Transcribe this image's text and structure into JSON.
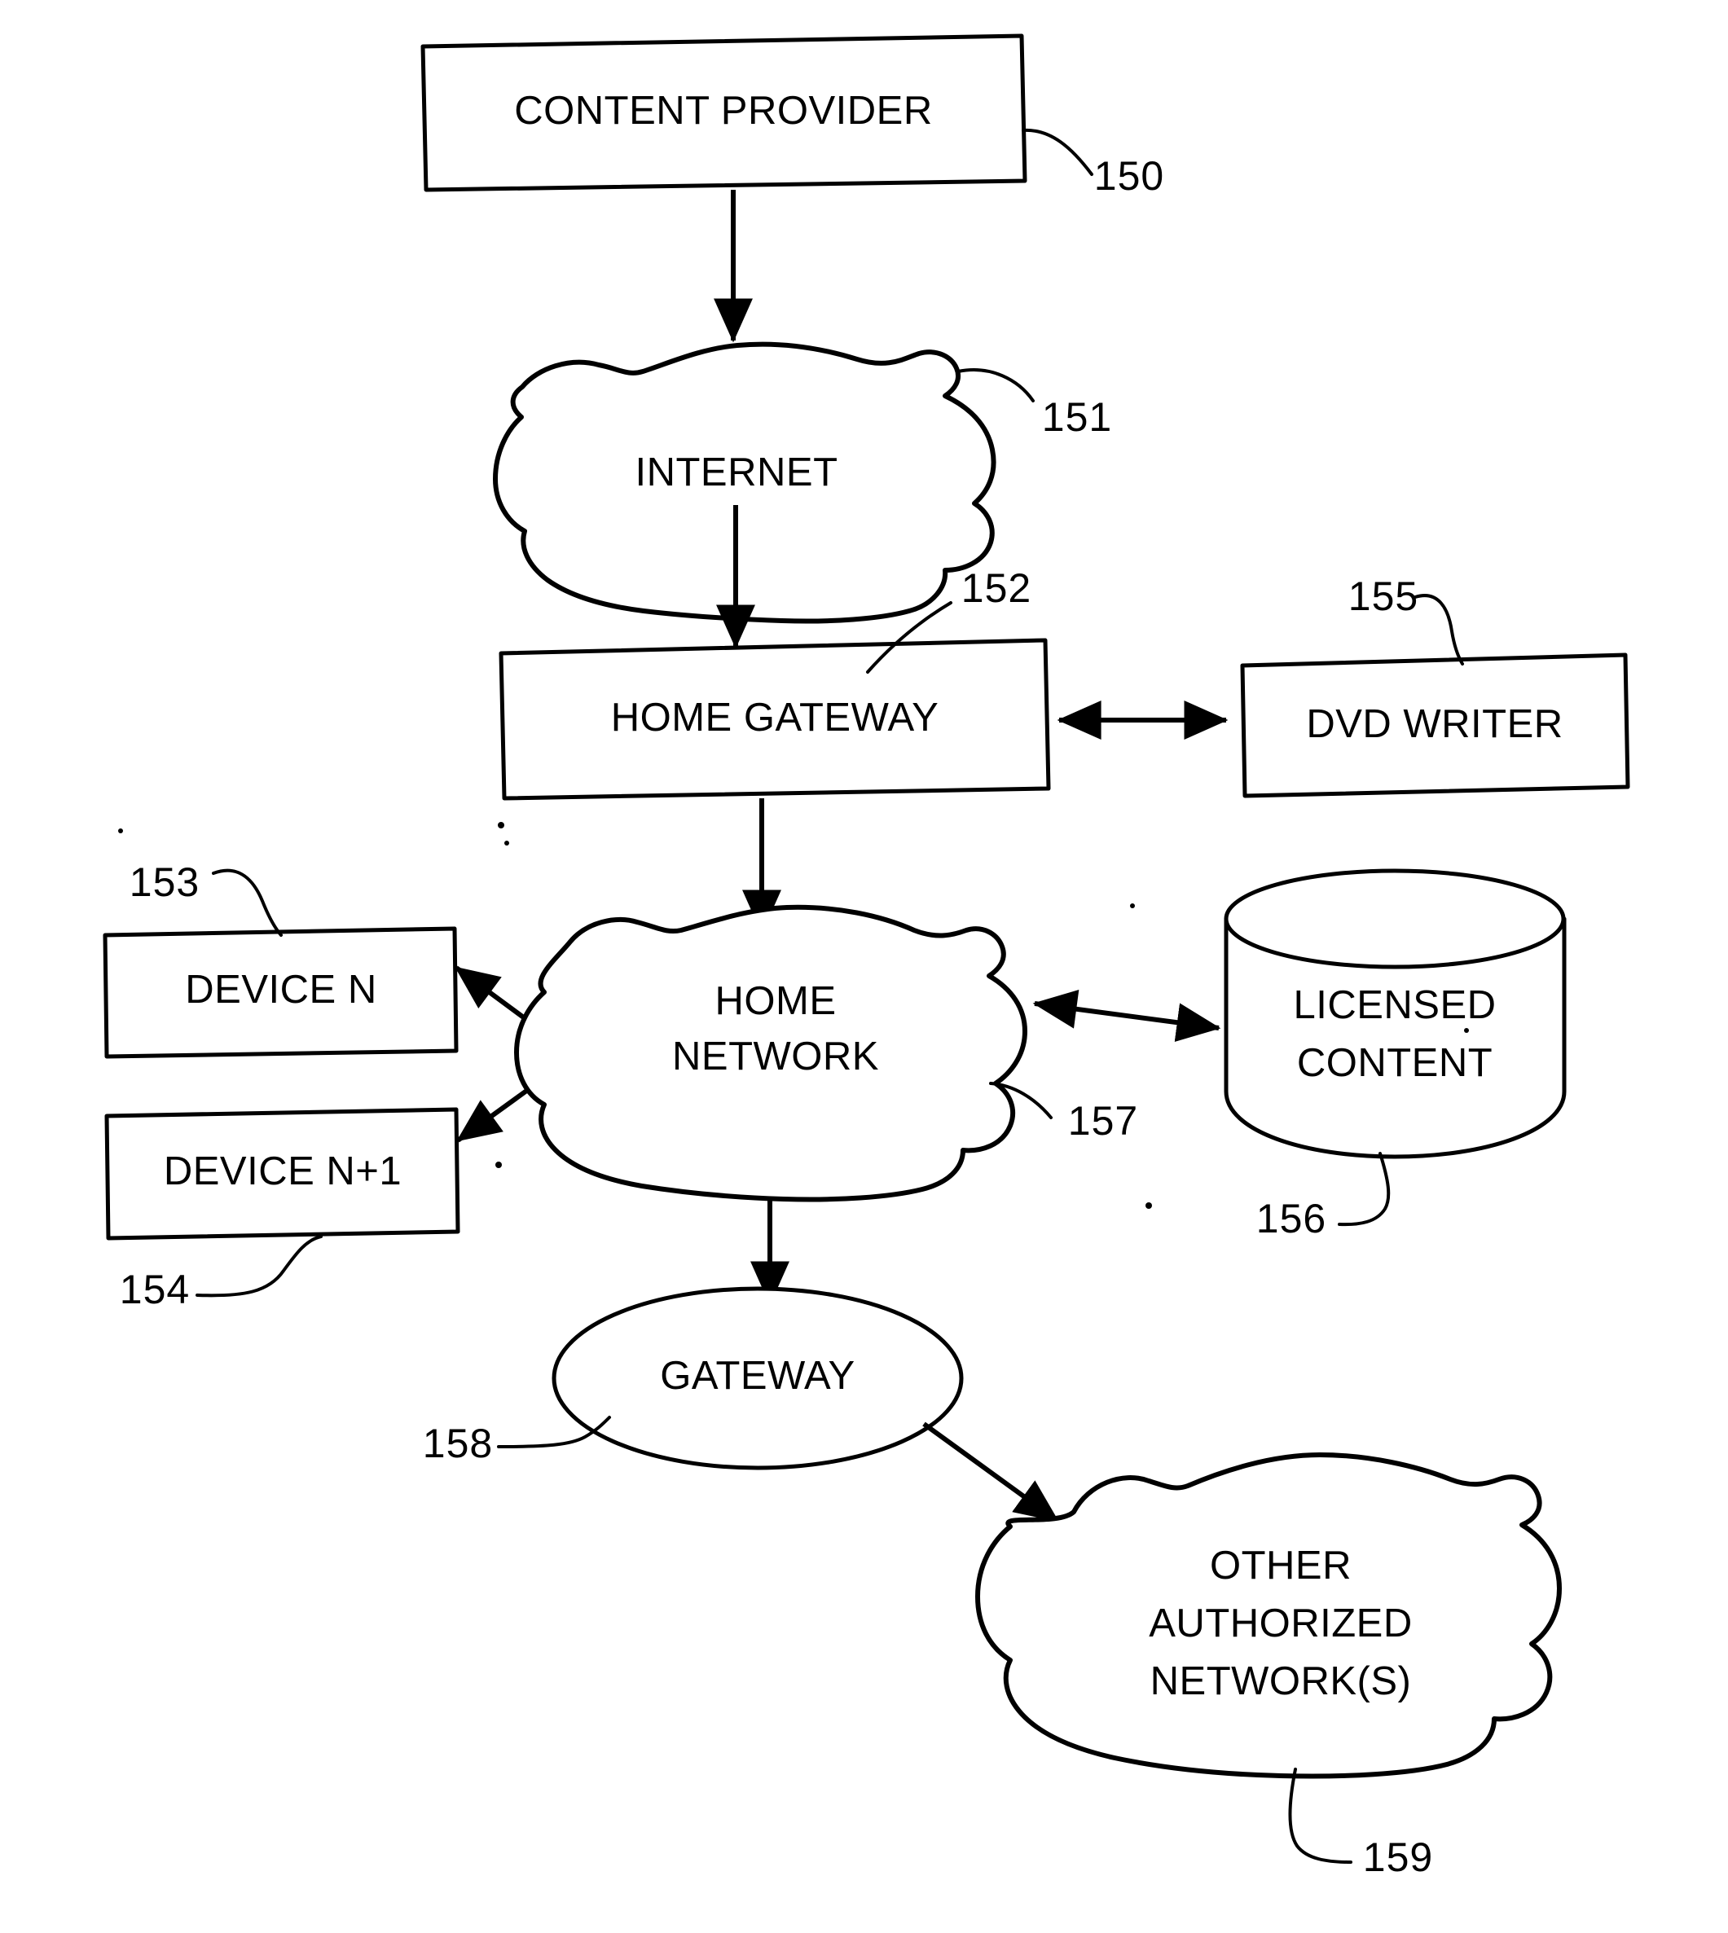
{
  "figure": {
    "type": "patent-block-diagram",
    "background_color": "#ffffff",
    "line_color": "#000000"
  },
  "nodes": {
    "content_provider": {
      "label": "CONTENT PROVIDER",
      "shape": "rectangle",
      "ref": "150"
    },
    "internet": {
      "label": "INTERNET",
      "shape": "cloud",
      "ref": "151"
    },
    "home_gateway": {
      "label": "HOME GATEWAY",
      "shape": "rectangle",
      "ref": "152"
    },
    "dvd_writer": {
      "label": "DVD WRITER",
      "shape": "rectangle",
      "ref": "155"
    },
    "device_n": {
      "label": "DEVICE N",
      "shape": "rectangle",
      "ref": "153"
    },
    "device_n_plus_1": {
      "label": "DEVICE N+1",
      "shape": "rectangle",
      "ref": "154"
    },
    "home_network": {
      "label_line1": "HOME",
      "label_line2": "NETWORK",
      "shape": "cloud",
      "ref": "157"
    },
    "licensed_content": {
      "label_line1": "LICENSED",
      "label_line2": "CONTENT",
      "shape": "cylinder",
      "ref": "156"
    },
    "gateway": {
      "label": "GATEWAY",
      "shape": "ellipse",
      "ref": "158"
    },
    "other_authorized_networks": {
      "label_line1": "OTHER",
      "label_line2": "AUTHORIZED",
      "label_line3": "NETWORK(S)",
      "shape": "cloud",
      "ref": "159"
    }
  },
  "reference_numerals": {
    "n150": "150",
    "n151": "151",
    "n152": "152",
    "n153": "153",
    "n154": "154",
    "n155": "155",
    "n156": "156",
    "n157": "157",
    "n158": "158",
    "n159": "159"
  },
  "connections": [
    {
      "from": "content_provider",
      "to": "internet",
      "arrow": "single"
    },
    {
      "from": "internet",
      "to": "home_gateway",
      "arrow": "single"
    },
    {
      "from": "home_gateway",
      "to": "dvd_writer",
      "arrow": "double"
    },
    {
      "from": "home_gateway",
      "to": "home_network",
      "arrow": "single"
    },
    {
      "from": "home_network",
      "to": "device_n",
      "arrow": "double"
    },
    {
      "from": "home_network",
      "to": "device_n_plus_1",
      "arrow": "double"
    },
    {
      "from": "home_network",
      "to": "licensed_content",
      "arrow": "double"
    },
    {
      "from": "home_network",
      "to": "gateway",
      "arrow": "single"
    },
    {
      "from": "gateway",
      "to": "other_authorized_networks",
      "arrow": "single"
    }
  ]
}
